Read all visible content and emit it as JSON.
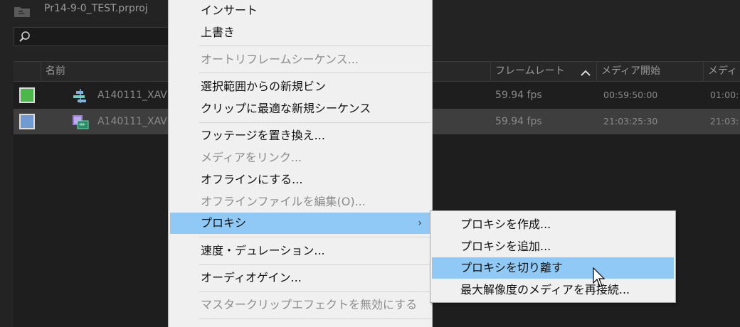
{
  "project": {
    "title": "Pr14-9-0_TEST.prproj",
    "search_placeholder": ""
  },
  "table": {
    "columns": {
      "name": "名前",
      "frame_rate": "フレームレート",
      "media_start": "メディア開始",
      "media_end": "メディ"
    },
    "rows": [
      {
        "label_color": "#4cb84c",
        "icon": "sequence-icon",
        "name": "A140111_XAV",
        "frame_rate": "59.94 fps",
        "media_start": "00:59:50:00",
        "media_end": "01:00:"
      },
      {
        "label_color": "#6f9ad2",
        "icon": "clip-icon",
        "name": "A140111_XAV",
        "frame_rate": "59.94 fps",
        "media_start": "21:03:25:30",
        "media_end": "21:03:"
      }
    ]
  },
  "context_menu": {
    "items": [
      {
        "label": "インサート",
        "enabled": true
      },
      {
        "label": "上書き",
        "enabled": true
      },
      {
        "label": "オートリフレームシーケンス...",
        "enabled": false
      },
      {
        "label": "選択範囲からの新規ビン",
        "enabled": true
      },
      {
        "label": "クリップに最適な新規シーケンス",
        "enabled": true
      },
      {
        "label": "フッテージを置き換え...",
        "enabled": true
      },
      {
        "label": "メディアをリンク...",
        "enabled": false
      },
      {
        "label": "オフラインにする...",
        "enabled": true
      },
      {
        "label": "オフラインファイルを編集(O)...",
        "enabled": false
      },
      {
        "label": "プロキシ",
        "enabled": true,
        "highlighted": true,
        "has_submenu": true
      },
      {
        "label": "速度・デュレーション...",
        "enabled": true
      },
      {
        "label": "オーディオゲイン...",
        "enabled": true
      },
      {
        "label": "マスタークリップエフェクトを無効にする",
        "enabled": false
      }
    ],
    "submenu_arrow": "›"
  },
  "proxy_submenu": {
    "items": [
      {
        "label": "プロキシを作成..."
      },
      {
        "label": "プロキシを追加..."
      },
      {
        "label": "プロキシを切り離す",
        "highlighted": true
      },
      {
        "label": "最大解像度のメディアを再接続..."
      }
    ]
  },
  "colors": {
    "menu_highlight": "#90c8f6",
    "panel_bg": "#232323"
  }
}
